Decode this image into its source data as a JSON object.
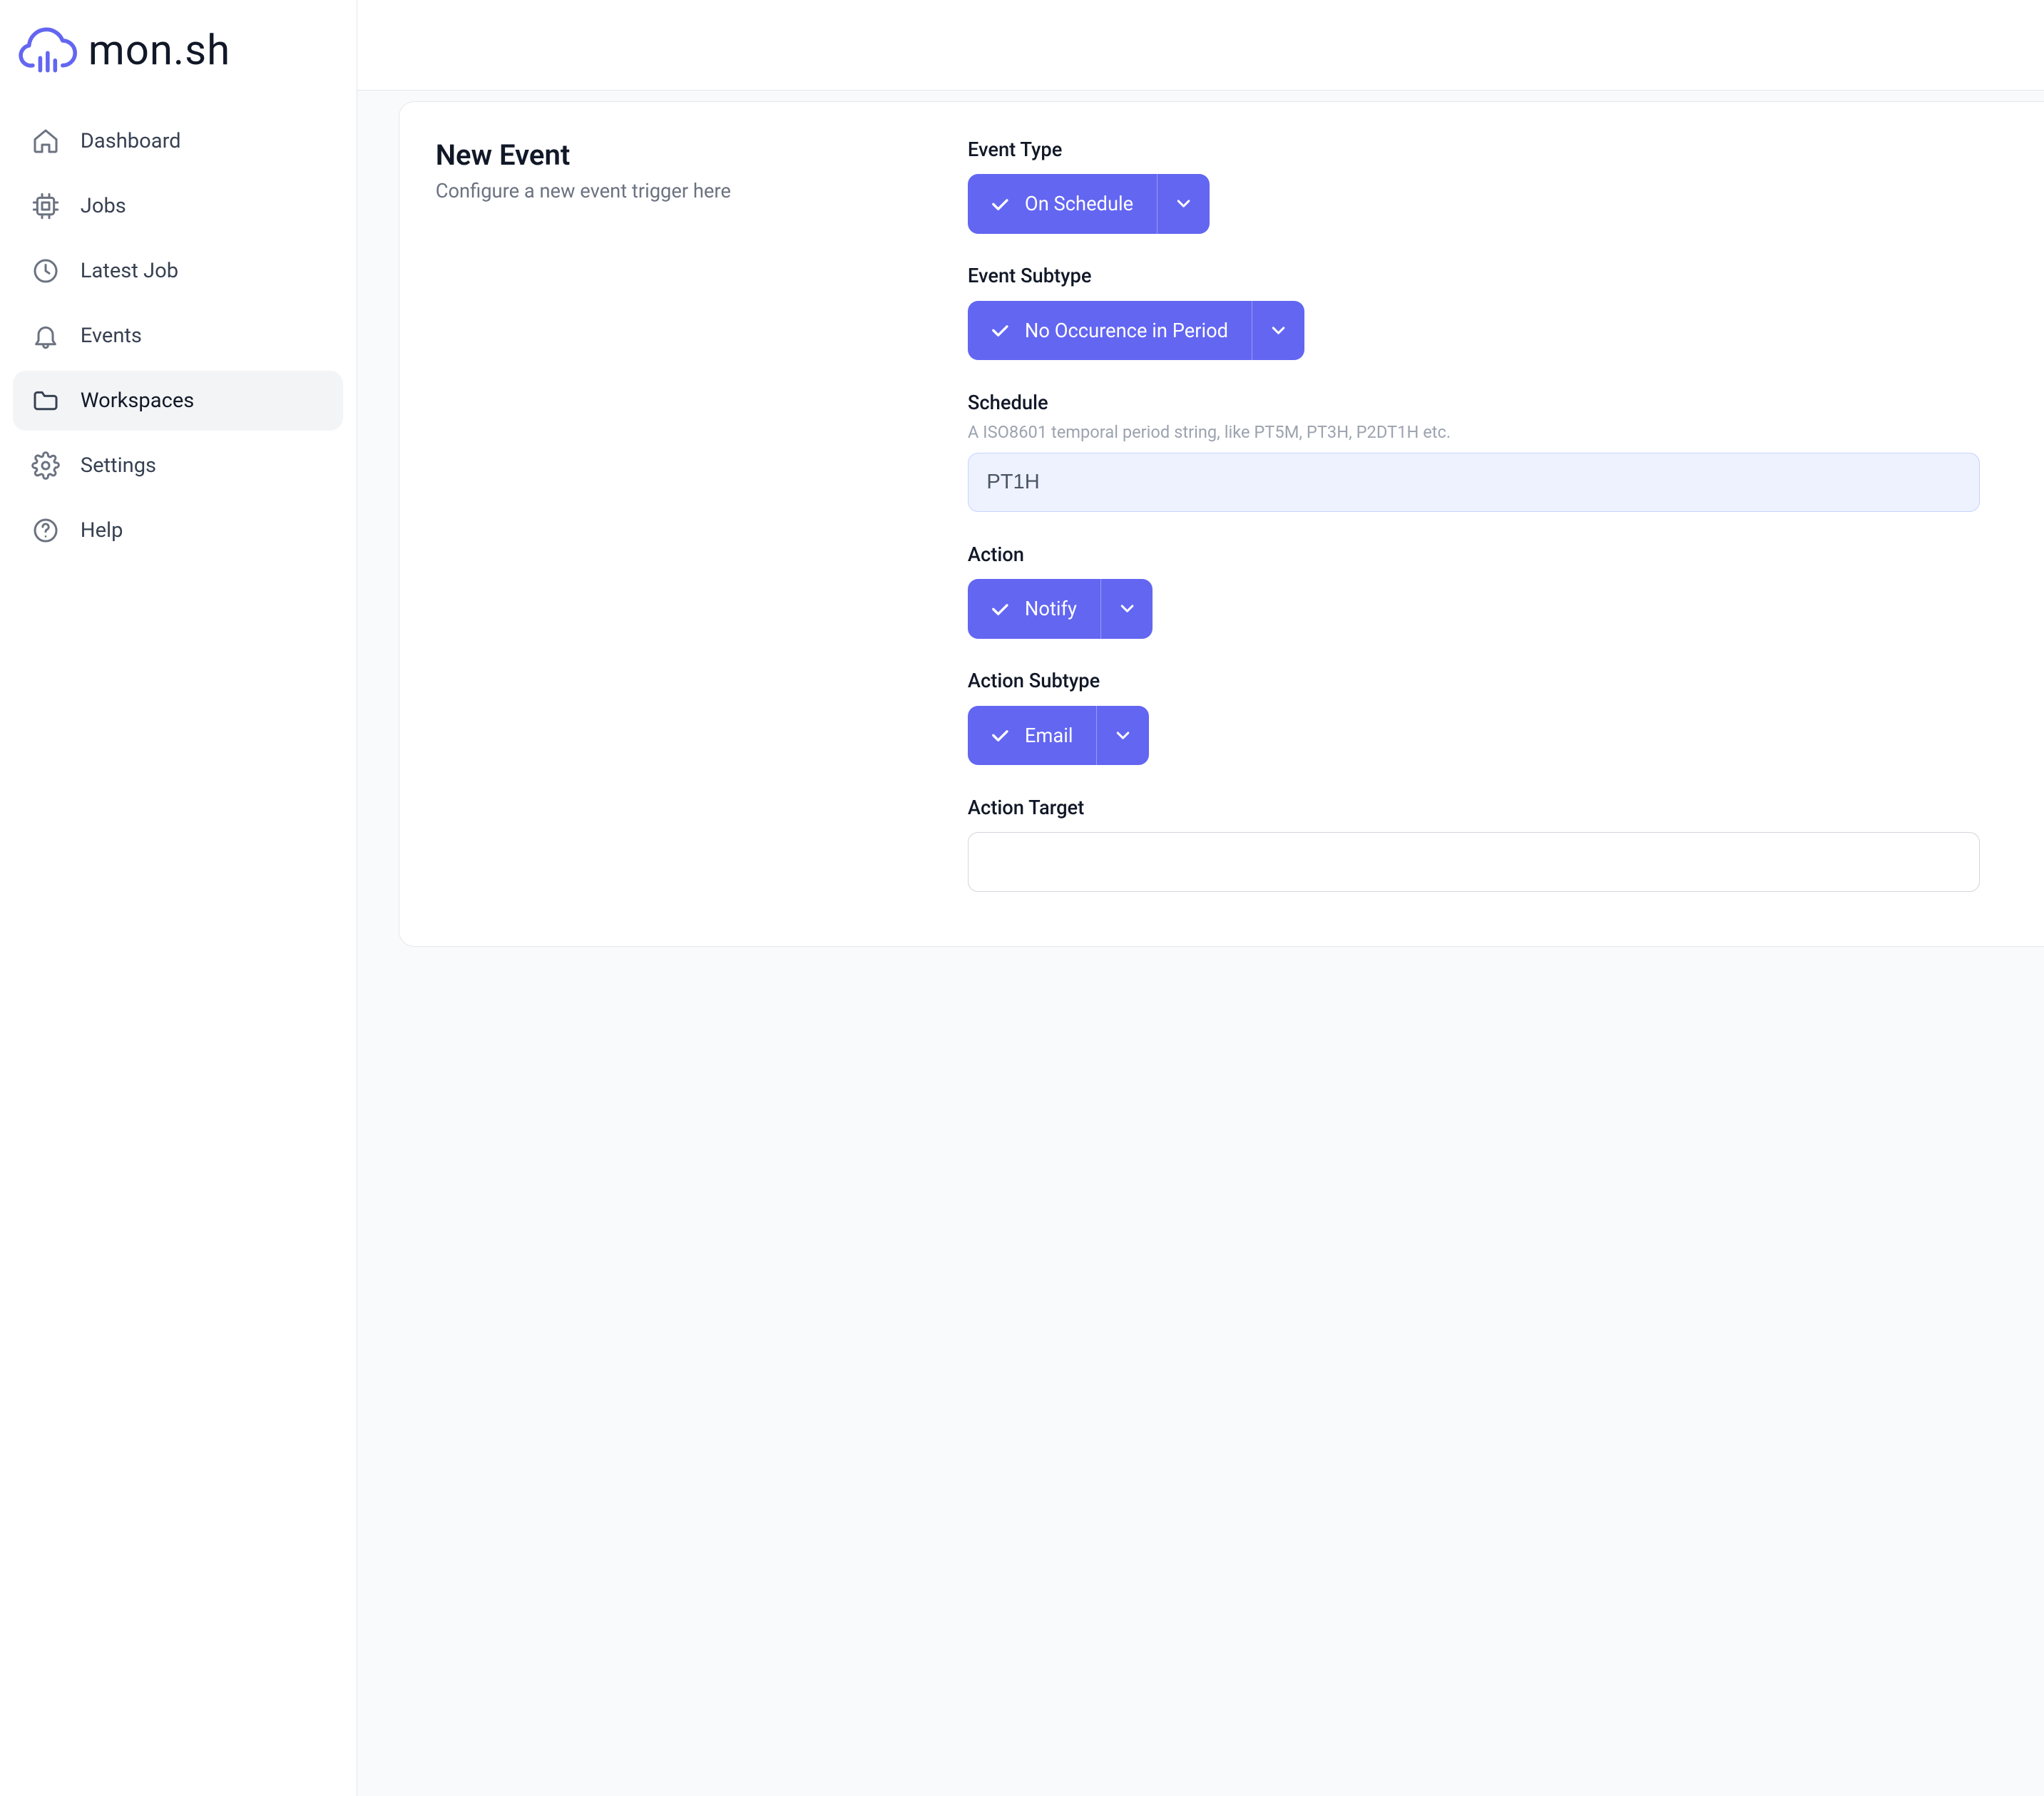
{
  "brand": {
    "name": "mon.sh"
  },
  "nav": {
    "dashboard": "Dashboard",
    "jobs": "Jobs",
    "latest_job": "Latest Job",
    "events": "Events",
    "workspaces": "Workspaces",
    "settings": "Settings",
    "help": "Help"
  },
  "header": {
    "title": "New Event",
    "subtitle": "Configure a new event trigger here"
  },
  "form": {
    "event_type": {
      "label": "Event Type",
      "selected": "On Schedule"
    },
    "event_subtype": {
      "label": "Event Subtype",
      "selected": "No Occurence in Period"
    },
    "schedule": {
      "label": "Schedule",
      "hint": "A ISO8601 temporal period string, like PT5M, PT3H, P2DT1H etc.",
      "value": "PT1H"
    },
    "action": {
      "label": "Action",
      "selected": "Notify"
    },
    "action_subtype": {
      "label": "Action Subtype",
      "selected": "Email"
    },
    "action_target": {
      "label": "Action Target",
      "value": ""
    }
  },
  "colors": {
    "accent": "#6366f1"
  }
}
